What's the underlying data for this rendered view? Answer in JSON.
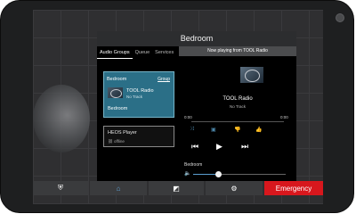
{
  "dialog": {
    "title": "Bedroom"
  },
  "tabs": [
    "Audio Groups",
    "Queue",
    "Services"
  ],
  "group_card": {
    "name": "Bedroom",
    "action": "Group",
    "track_title": "TOOL Radio",
    "track_subtitle": "No Track",
    "footer": "Bedroom"
  },
  "device": {
    "name": "HEOS Player",
    "status": "offline"
  },
  "now_playing": {
    "banner": "Now playing from TOOL Radio",
    "title": "TOOL Radio",
    "subtitle": "No Track",
    "elapsed": "0:00",
    "remaining": "0:00",
    "progress_fraction": 0
  },
  "volume": {
    "zone": "Bedroom",
    "level_fraction": 0.27
  },
  "bottom_bar": {
    "emergency_label": "Emergency"
  },
  "icons": [
    "shield-icon",
    "home-icon",
    "scene-icon",
    "gear-icon",
    "shuffle-icon",
    "queue-icon",
    "thumbs-down-icon",
    "thumbs-up-icon",
    "skip-back-icon",
    "play-icon",
    "skip-forward-icon",
    "volume-icon",
    "link-icon"
  ],
  "colors": {
    "accent_blue": "#2b6f87",
    "emergency": "#d8171d",
    "slider": "#5b9fd0"
  }
}
